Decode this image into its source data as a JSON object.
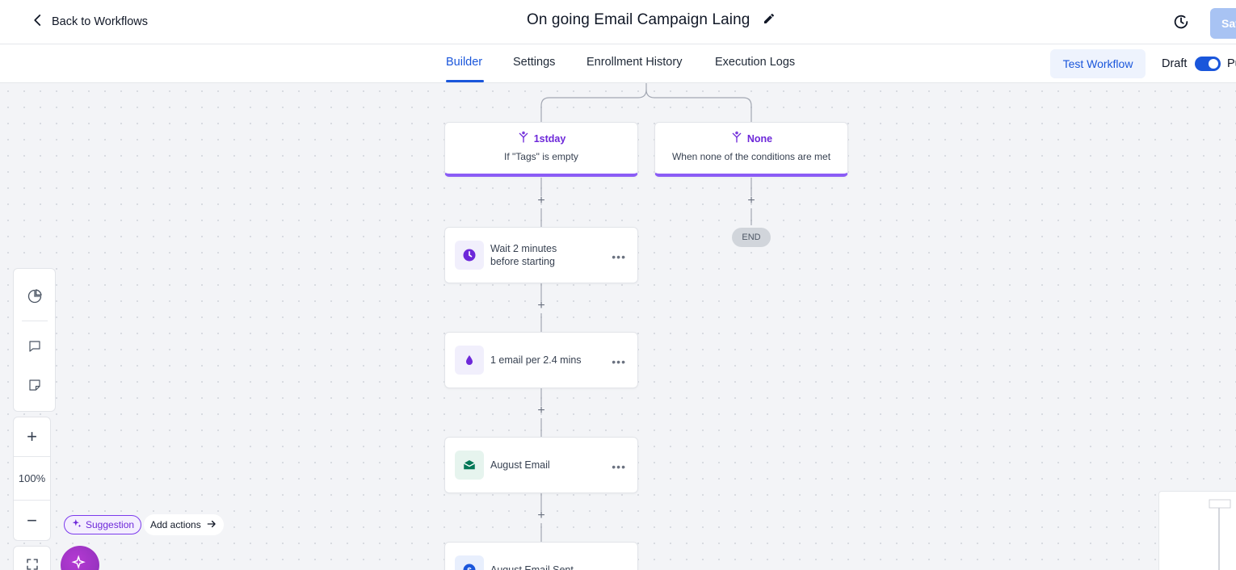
{
  "header": {
    "back_label": "Back to Workflows",
    "title": "On going Email Campaign Laing",
    "save_label": "Save"
  },
  "tabs": [
    {
      "label": "Builder",
      "active": true
    },
    {
      "label": "Settings",
      "active": false
    },
    {
      "label": "Enrollment History",
      "active": false
    },
    {
      "label": "Execution Logs",
      "active": false
    }
  ],
  "toolbar_right": {
    "test_label": "Test Workflow",
    "draft_label": "Draft",
    "publish_label": "Publish",
    "publish_enabled": true
  },
  "branches": [
    {
      "name": "1stday",
      "description": "If \"Tags\" is empty"
    },
    {
      "name": "None",
      "description": "When none of the conditions are met"
    }
  ],
  "actions": [
    {
      "label": "Wait 2 minutes before starting",
      "icon": "clock-icon"
    },
    {
      "label": "1 email per 2.4 mins",
      "icon": "drip-icon"
    },
    {
      "label": "August Email",
      "icon": "email-icon"
    },
    {
      "label": "August Email Sent",
      "icon": "dollar-icon"
    }
  ],
  "end_label": "END",
  "zoom": {
    "level": "100%"
  },
  "suggestion": {
    "badge": "Suggestion",
    "action": "Add actions"
  },
  "colors": {
    "accent": "#1a56db",
    "branch": "#8b5cf6",
    "purple_text": "#6d28d9",
    "email_green": "#047857"
  }
}
